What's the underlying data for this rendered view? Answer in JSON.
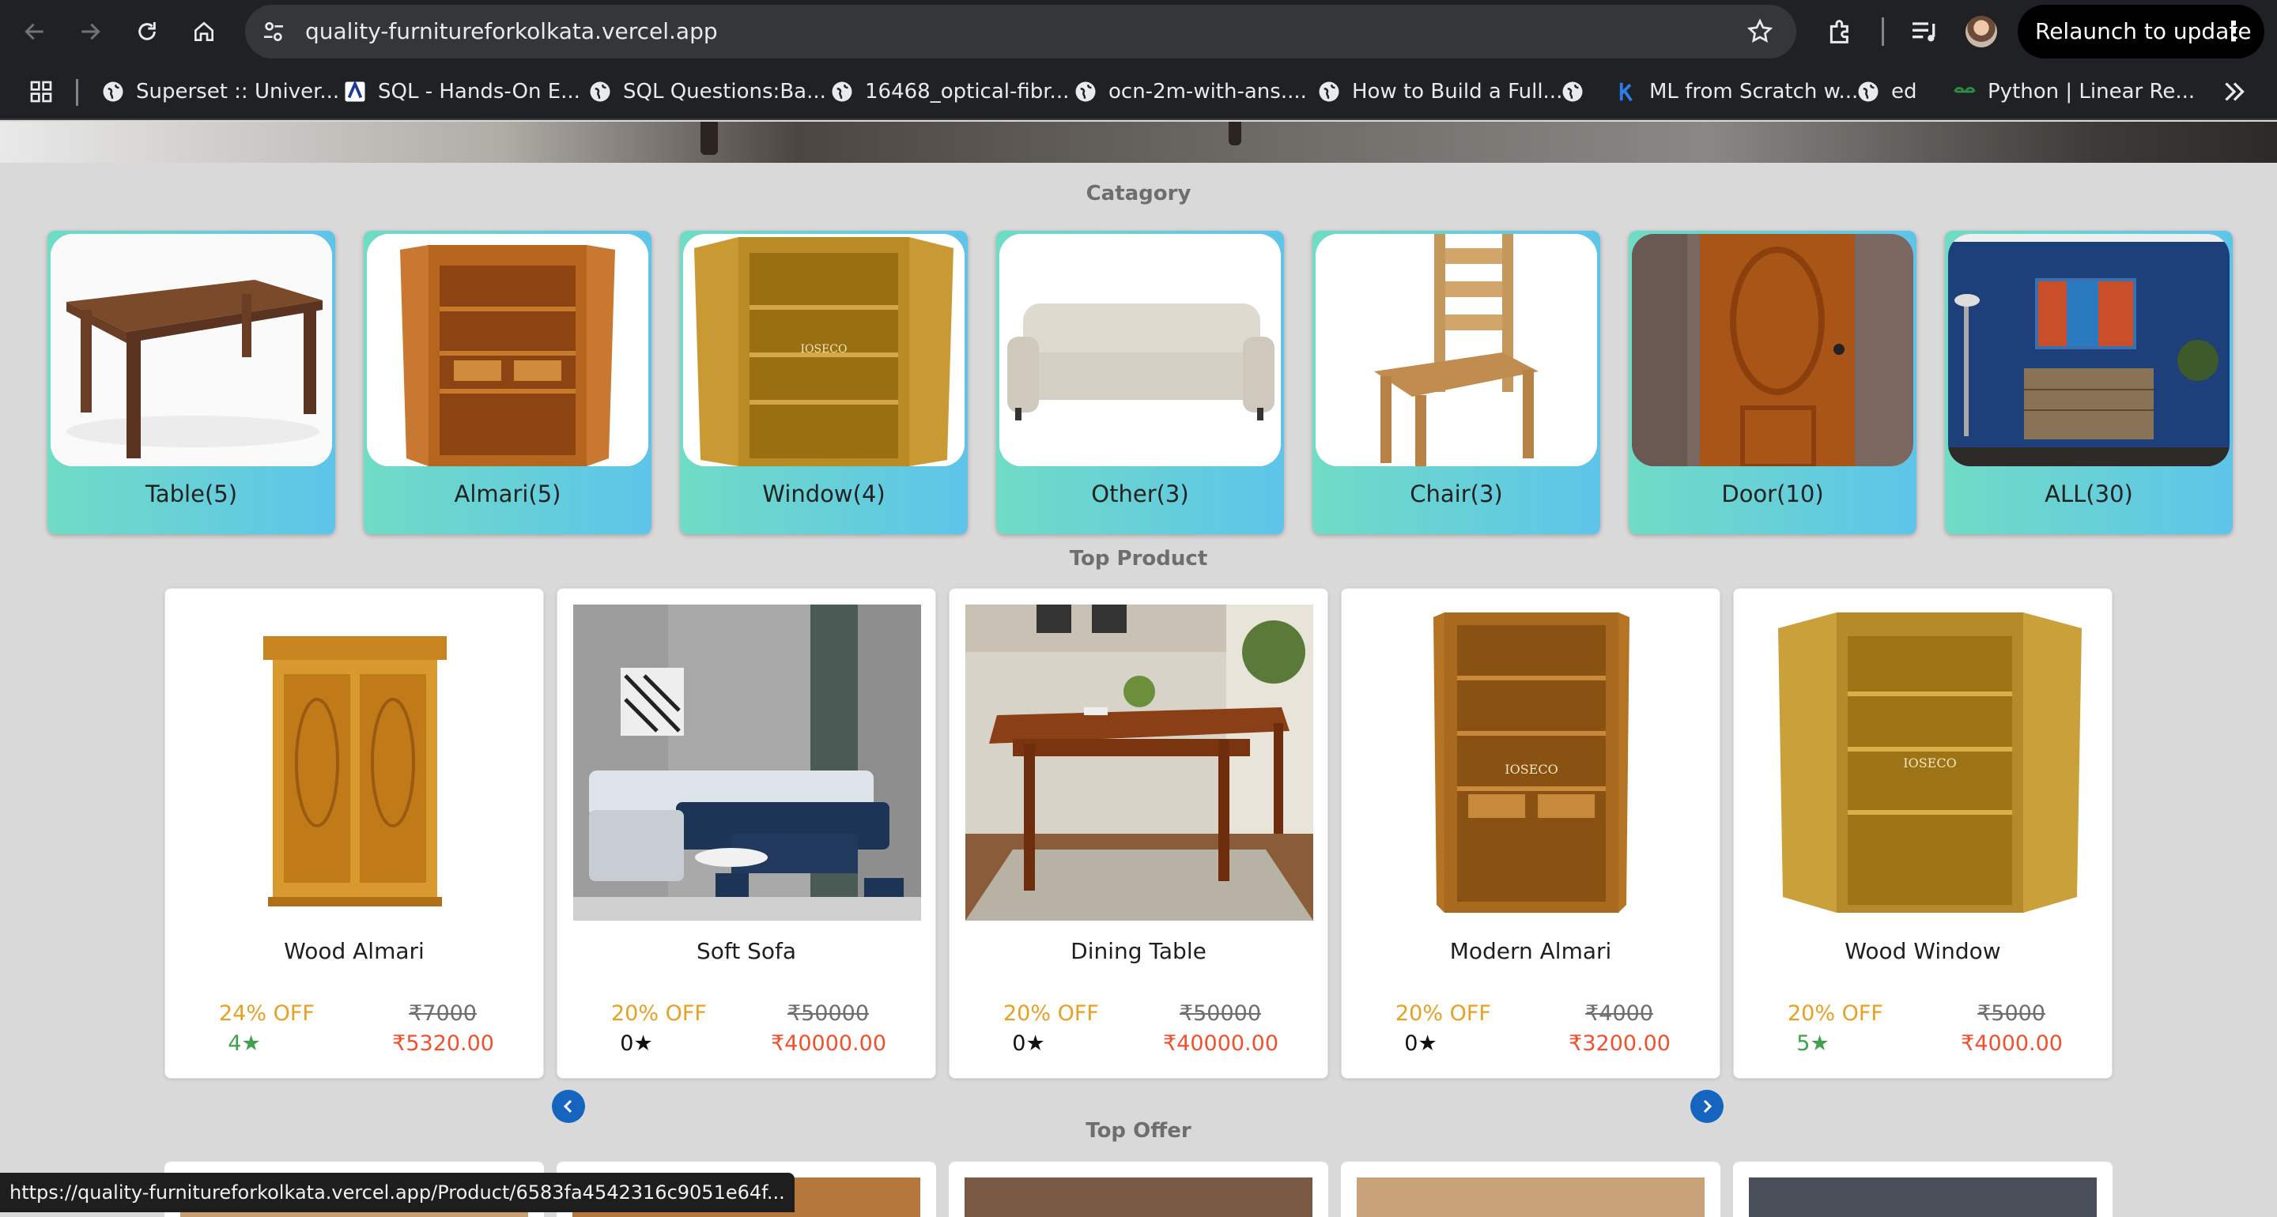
{
  "browser": {
    "url": "quality-furnitureforkolkata.vercel.app",
    "relaunch_label": "Relaunch to update",
    "bookmarks": [
      {
        "label": "Superset :: Univer...",
        "icon": "globe-icon"
      },
      {
        "label": "SQL - Hands-On E...",
        "icon": "site-favicon"
      },
      {
        "label": "SQL Questions:Ba...",
        "icon": "globe-icon"
      },
      {
        "label": "16468_optical-fibr...",
        "icon": "globe-icon"
      },
      {
        "label": "ocn-2m-with-ans....",
        "icon": "globe-icon"
      },
      {
        "label": "How to Build a Full...",
        "icon": "globe-icon"
      },
      {
        "label": "",
        "icon": "globe-icon"
      },
      {
        "label": "ML from Scratch w...",
        "icon": "k-icon"
      },
      {
        "label": "ed",
        "icon": "globe-icon"
      },
      {
        "label": "Python | Linear Re...",
        "icon": "gfg-icon"
      }
    ],
    "status_url": "https://quality-furnitureforkolkata.vercel.app/Product/6583fa4542316c9051e64f..."
  },
  "page": {
    "category_title": "Catagory",
    "categories": [
      {
        "label": "Table(5)",
        "image": "table"
      },
      {
        "label": "Almari(5)",
        "image": "almari"
      },
      {
        "label": "Window(4)",
        "image": "window"
      },
      {
        "label": "Other(3)",
        "image": "sofa"
      },
      {
        "label": "Chair(3)",
        "image": "chair"
      },
      {
        "label": "Door(10)",
        "image": "door"
      },
      {
        "label": "ALL(30)",
        "image": "room"
      }
    ],
    "top_product_title": "Top Product",
    "products": [
      {
        "name": "Wood Almari",
        "discount": "24% OFF",
        "rating": "4",
        "rating_color": "#3fa34d",
        "old_price": "₹7000",
        "new_price": "₹5320.00"
      },
      {
        "name": "Soft Sofa",
        "discount": "20% OFF",
        "rating": "0",
        "rating_color": "#111111",
        "old_price": "₹50000",
        "new_price": "₹40000.00"
      },
      {
        "name": "Dining Table",
        "discount": "20% OFF",
        "rating": "0",
        "rating_color": "#111111",
        "old_price": "₹50000",
        "new_price": "₹40000.00"
      },
      {
        "name": "Modern Almari",
        "discount": "20% OFF",
        "rating": "0",
        "rating_color": "#111111",
        "old_price": "₹4000",
        "new_price": "₹3200.00"
      },
      {
        "name": "Wood Window",
        "discount": "20% OFF",
        "rating": "5",
        "rating_color": "#3fa34d",
        "old_price": "₹5000",
        "new_price": "₹4000.00"
      }
    ],
    "top_offer_title": "Top Offer",
    "colors": {
      "category_gradient_start": "#6fdcc4",
      "category_gradient_end": "#5ec4ea",
      "discount": "#e8a021",
      "price": "#f1502f",
      "arrow": "#1565c0"
    }
  }
}
